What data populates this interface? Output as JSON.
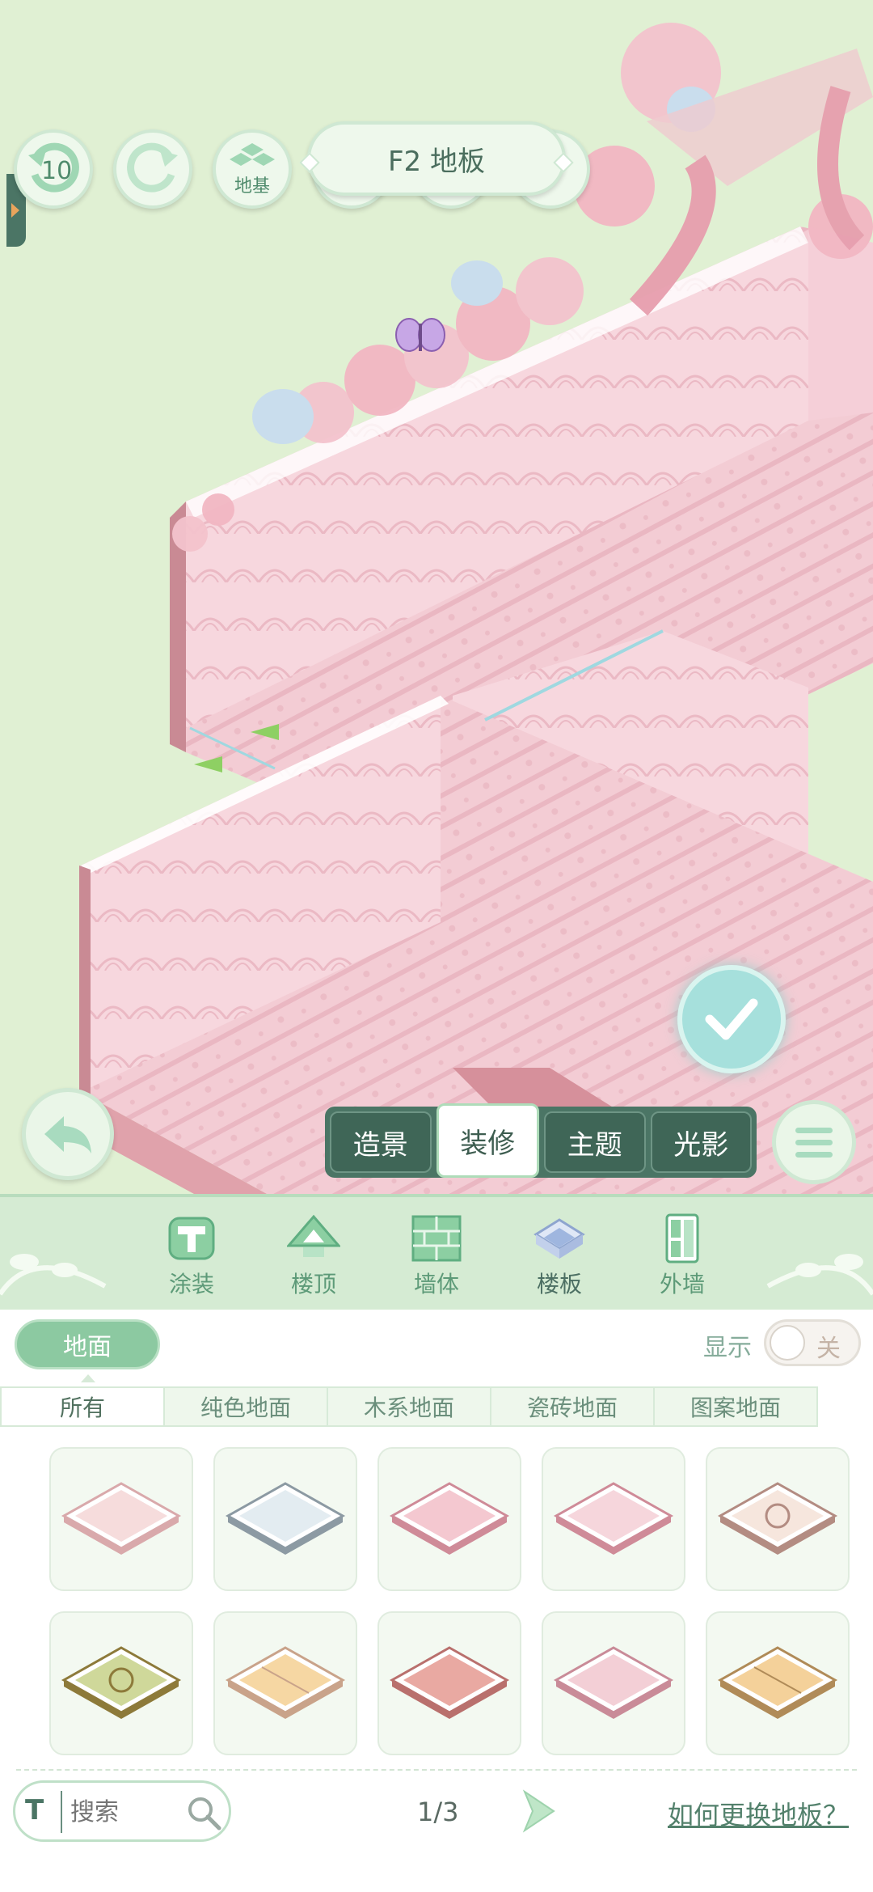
{
  "toolbar": {
    "undo_count": "10",
    "foundation_label": "地基",
    "floor_title": "F2 地板"
  },
  "mode_tabs": [
    {
      "label": "造景",
      "active": false
    },
    {
      "label": "装修",
      "active": true
    },
    {
      "label": "主题",
      "active": false
    },
    {
      "label": "光影",
      "active": false
    }
  ],
  "categories": [
    {
      "label": "涂装",
      "icon": "paint-bucket-icon",
      "active": false
    },
    {
      "label": "楼顶",
      "icon": "roof-icon",
      "active": false
    },
    {
      "label": "墙体",
      "icon": "brick-wall-icon",
      "active": false
    },
    {
      "label": "楼板",
      "icon": "floor-slab-icon",
      "active": true
    },
    {
      "label": "外墙",
      "icon": "exterior-wall-icon",
      "active": false
    }
  ],
  "panel": {
    "section_label": "地面",
    "display_label": "显示",
    "toggle_state": "关",
    "subtabs": [
      {
        "label": "所有",
        "active": true
      },
      {
        "label": "纯色地面",
        "active": false
      },
      {
        "label": "木系地面",
        "active": false
      },
      {
        "label": "瓷砖地面",
        "active": false
      },
      {
        "label": "图案地面",
        "active": false
      }
    ],
    "tiles": [
      {
        "name": "floor-tile-light-pink",
        "top": "#f6dcdc",
        "edge": "#d9a9ab",
        "pattern": "plain"
      },
      {
        "name": "floor-tile-blue-grey",
        "top": "#e3ecf1",
        "edge": "#8c9aa3",
        "pattern": "plain"
      },
      {
        "name": "floor-tile-pink",
        "top": "#f4c8d0",
        "edge": "#cf8b98",
        "pattern": "plain"
      },
      {
        "name": "floor-tile-pink-wood",
        "top": "#f6d6dc",
        "edge": "#cf8b98",
        "pattern": "plain"
      },
      {
        "name": "floor-tile-cream-pattern",
        "top": "#f6e6dd",
        "edge": "#b38c82",
        "pattern": "pattern"
      },
      {
        "name": "floor-tile-green-gold-pattern",
        "top": "#cfd89a",
        "edge": "#8d7a3a",
        "pattern": "pattern"
      },
      {
        "name": "floor-tile-yellow-wood",
        "top": "#f6d7a3",
        "edge": "#c9a38a",
        "pattern": "wood"
      },
      {
        "name": "floor-tile-rose",
        "top": "#e9a9a2",
        "edge": "#b9706d",
        "pattern": "plain"
      },
      {
        "name": "floor-tile-pink-lace",
        "top": "#f3cfd6",
        "edge": "#c98b98",
        "pattern": "plain"
      },
      {
        "name": "floor-tile-wood-parquet",
        "top": "#f4d19a",
        "edge": "#b08b58",
        "pattern": "wood"
      }
    ],
    "search_placeholder": "搜索",
    "page_indicator": "1/3",
    "help_link": "如何更换地板？"
  }
}
